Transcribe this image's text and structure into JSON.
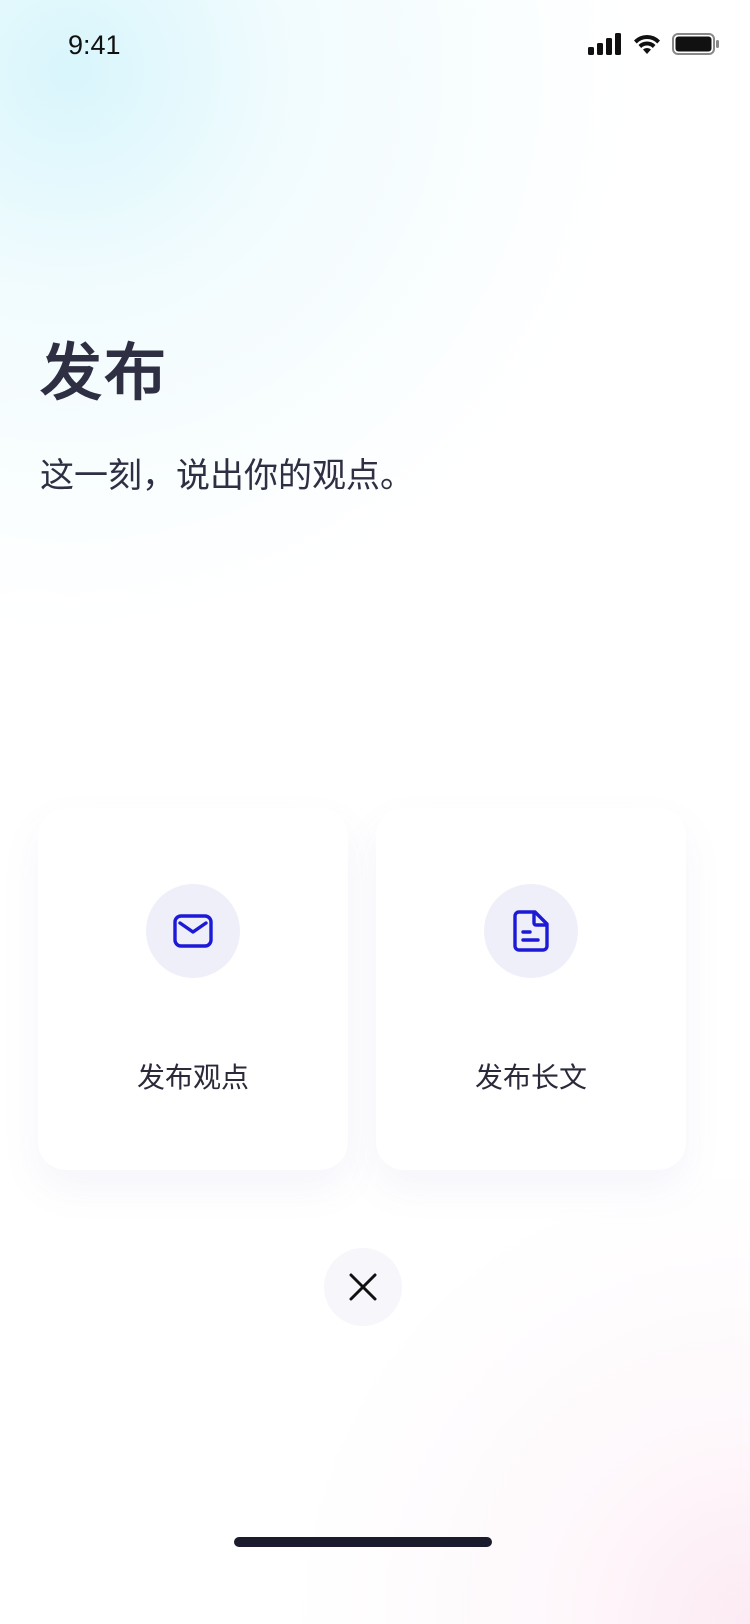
{
  "status_bar": {
    "time": "9:41",
    "icons": [
      "cellular-signal-icon",
      "wifi-icon",
      "battery-icon"
    ]
  },
  "header": {
    "title": "发布",
    "subtitle": "这一刻，说出你的观点。"
  },
  "options": [
    {
      "label": "发布观点",
      "icon": "envelope-icon"
    },
    {
      "label": "发布长文",
      "icon": "document-icon"
    }
  ],
  "colors": {
    "accent": "#1c1ad6",
    "icon_bg": "#efeffa",
    "text": "#2f2f44"
  },
  "close": {
    "icon": "close-icon"
  }
}
